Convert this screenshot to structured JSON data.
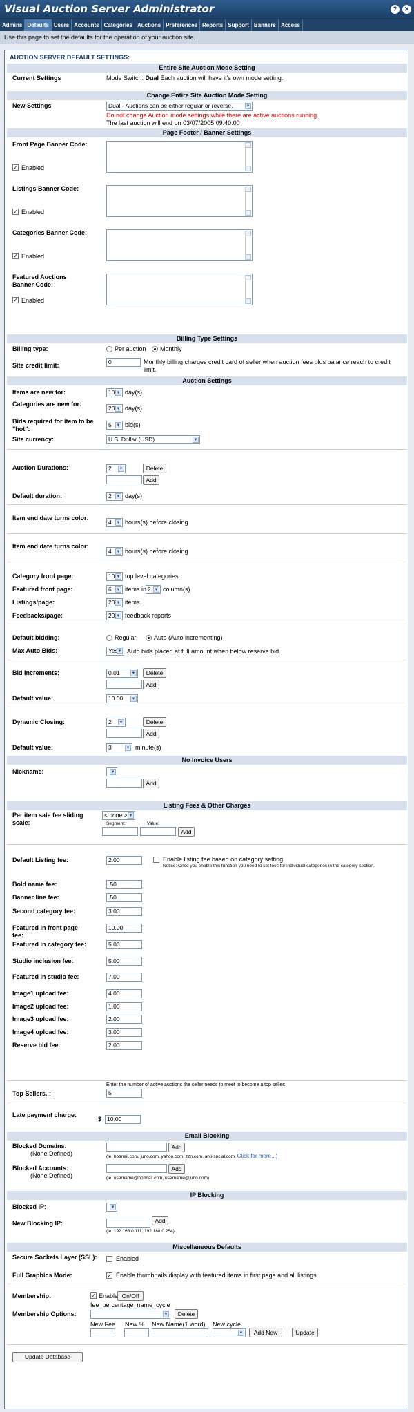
{
  "window": {
    "title": "Visual Auction Server Administrator",
    "help_icon": "?",
    "close_icon": "✕"
  },
  "nav": [
    "Admins",
    "Defaults",
    "Users",
    "Accounts",
    "Categories",
    "Auctions",
    "Preferences",
    "Reports",
    "Support",
    "Banners",
    "Access"
  ],
  "intro": "Use this page to set the defaults for the operation of your auction site.",
  "panel_title": "AUCTION SERVER DEFAULT SETTINGS:",
  "sections": {
    "mode": "Entire Site Auction Mode Setting",
    "change_mode": "Change Entire Site Auction Mode Setting",
    "footer": "Page Footer / Banner Settings",
    "billing": "Billing Type Settings",
    "auction": "Auction Settings",
    "no_invoice": "No Invoice Users",
    "fees": "Listing Fees & Other Charges",
    "email_block": "Email Blocking",
    "ip_block": "IP Blocking",
    "misc": "Miscellaneous Defaults"
  },
  "mode": {
    "label": "Current Settings",
    "text_a": "Mode Switch: ",
    "text_b": "Dual",
    "text_c": " Each auction will have it's own mode setting."
  },
  "change_mode": {
    "label": "New Settings",
    "select": "Dual - Auctions can be either regular or reverse.",
    "warning": "Do not change Auction mode settings while there are active auctions running.",
    "last": "The last auction will end on 03/07/2005 09:40:00"
  },
  "banners": [
    {
      "label": "Front Page Banner Code:",
      "enabled": "Enabled"
    },
    {
      "label": "Listings Banner Code:",
      "enabled": "Enabled"
    },
    {
      "label": "Categories Banner Code:",
      "enabled": "Enabled"
    },
    {
      "label": "Featured Auctions Banner Code:",
      "enabled": "Enabled"
    }
  ],
  "billing": {
    "type_label": "Billing type:",
    "opt1": "Per auction",
    "opt2": "Monthly",
    "credit_label": "Site credit limit:",
    "credit_value": "0",
    "credit_note": "Monthly billing charges credit card of seller when auction fees plus balance reach to credit limit."
  },
  "auction": {
    "items_new": {
      "label": "Items are new for:",
      "value": "10",
      "unit": "day(s)"
    },
    "cats_new": {
      "label": "Categories are new for:",
      "value": "20",
      "unit": "day(s)"
    },
    "bids_hot": {
      "label": "Bids required for item to be \"hot\":",
      "value": "5",
      "unit": "bid(s)"
    },
    "currency": {
      "label": "Site currency:",
      "value": "U.S. Dollar (USD)"
    },
    "durations": {
      "label": "Auction Durations:",
      "value": "2",
      "delete": "Delete",
      "add": "Add"
    },
    "default_dur": {
      "label": "Default duration:",
      "value": "2",
      "unit": "day(s)"
    },
    "end_color1": {
      "label": "Item end date turns color:",
      "value": "4",
      "unit": "hours(s) before closing"
    },
    "end_color2": {
      "label": "Item end date turns color:",
      "value": "4",
      "unit": "hours(s) before closing"
    },
    "cat_front": {
      "label": "Category front page:",
      "value": "10",
      "unit": "top level categories"
    },
    "feat_front": {
      "label": "Featured front page:",
      "value": "6",
      "mid": "items in",
      "value2": "2",
      "unit": "column(s)"
    },
    "listings_page": {
      "label": "Listings/page:",
      "value": "20",
      "unit": "items"
    },
    "feedbacks_page": {
      "label": "Feedbacks/page:",
      "value": "20",
      "unit": "feedback reports"
    },
    "default_bidding": {
      "label": "Default bidding:",
      "opt1": "Regular",
      "opt2": "Auto (Auto incrementing)"
    },
    "max_auto": {
      "label": "Max Auto Bids:",
      "value": "Yes",
      "note": "Auto bids placed at full amount when below reserve bid."
    },
    "bid_inc": {
      "label": "Bid Increments:",
      "value": "0.01",
      "delete": "Delete",
      "add": "Add"
    },
    "bid_default": {
      "label": "Default value:",
      "value": "10.00"
    },
    "dyn_close": {
      "label": "Dynamic Closing:",
      "value": "2",
      "delete": "Delete",
      "add": "Add"
    },
    "dyn_default": {
      "label": "Default value:",
      "value": "3",
      "unit": "minute(s)"
    }
  },
  "no_invoice": {
    "label": "Nickname:",
    "add": "Add"
  },
  "fees": {
    "scale_label": "Per item sale fee sliding scale:",
    "scale_value": "< none >",
    "segment": "Segment:",
    "value": "Value:",
    "add": "Add",
    "default_label": "Default Listing fee:",
    "default_value": "2.00",
    "cat_check": "Enable listing fee based on category setting",
    "cat_notice": "Notice: Once you enable this function you need to set fees for individual categories in the category section.",
    "items": [
      {
        "label": "Bold name fee:",
        "value": ".50"
      },
      {
        "label": "Banner line fee:",
        "value": ".50"
      },
      {
        "label": "Second category fee:",
        "value": "3.00"
      },
      {
        "label": "Featured in front page fee:",
        "value": "10.00"
      },
      {
        "label": "Featured in category fee:",
        "value": "5.00"
      },
      {
        "label": "Studio inclusion fee:",
        "value": "5.00"
      },
      {
        "label": "Featured in studio fee:",
        "value": "7.00"
      },
      {
        "label": "Image1 upload fee:",
        "value": "4.00"
      },
      {
        "label": "Image2 upload fee:",
        "value": "1.00"
      },
      {
        "label": "Image3 upload fee:",
        "value": "2.00"
      },
      {
        "label": "Image4 upload fee:",
        "value": "3.00"
      },
      {
        "label": "Reserve bid fee:",
        "value": "2.00"
      }
    ],
    "top_label": "Top Sellers. :",
    "top_note": "Enter the number of active auctions the seller needs to meet to become a top seller:",
    "top_value": "5",
    "late_label": "Late payment charge:",
    "late_currency": "$",
    "late_value": "10.00"
  },
  "email": {
    "domains_label": "Blocked Domains:",
    "domains_none": "(None Defined)",
    "domains_add": "Add",
    "domains_ex": "(ie. hotmail.com, juno.com, yahoo.com, zzn.com, anti-social.com, ",
    "domains_more": "Click for more...)",
    "accounts_label": "Blocked Accounts:",
    "accounts_none": "(None Defined)",
    "accounts_add": "Add",
    "accounts_ex": "(ie. username@hotmail.com, username@juno.com)"
  },
  "ip": {
    "blocked_label": "Blocked IP:",
    "new_label": "New Blocking IP:",
    "add": "Add",
    "ex": "(ie. 192.168.0.111, 192.168.0.254)"
  },
  "misc": {
    "ssl_label": "Secure Sockets Layer (SSL):",
    "ssl_text": "Enabled",
    "graphics_label": "Full Graphics Mode:",
    "graphics_text": "Enable thumbnails display with featured items in first page and all listings."
  },
  "membership": {
    "label": "Membership:",
    "enable": "Enable",
    "onoff": "On/Off",
    "options_label": "Membership Options:",
    "cycle": "fee_percentage_name_cycle",
    "delete": "Delete",
    "new_fee": "New Fee",
    "new_pct": "New %",
    "new_name": "New Name(1 word)",
    "new_cycle": "New cycle",
    "add_new": "Add New",
    "update": "Update"
  },
  "update_db": "Update Database"
}
